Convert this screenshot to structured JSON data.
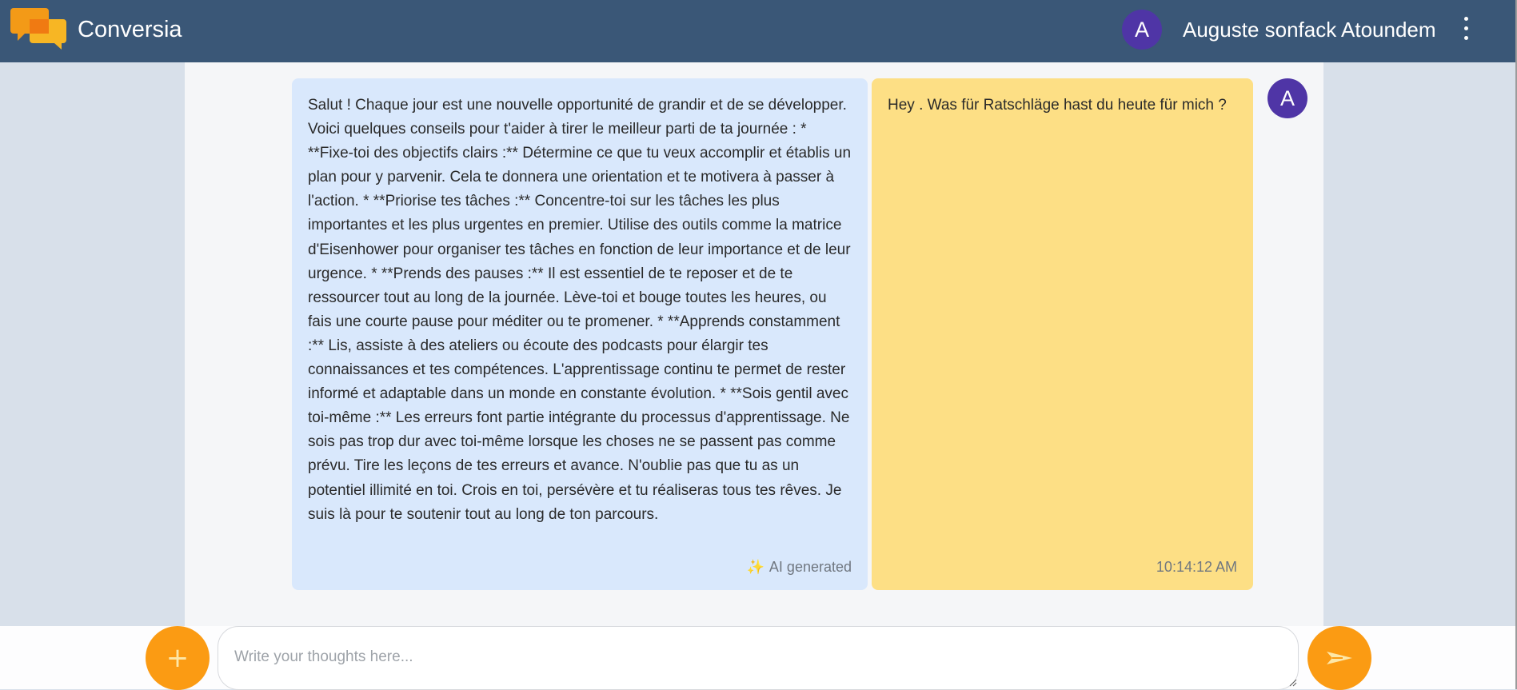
{
  "header": {
    "app_name": "Conversia",
    "user_initial": "A",
    "user_name": "Auguste sonfack Atoundem"
  },
  "chat": {
    "ai_message": {
      "text": "Salut ! Chaque jour est une nouvelle opportunité de grandir et de se développer. Voici quelques conseils pour t'aider à tirer le meilleur parti de ta journée : * **Fixe-toi des objectifs clairs :** Détermine ce que tu veux accomplir et établis un plan pour y parvenir. Cela te donnera une orientation et te motivera à passer à l'action. * **Priorise tes tâches :** Concentre-toi sur les tâches les plus importantes et les plus urgentes en premier. Utilise des outils comme la matrice d'Eisenhower pour organiser tes tâches en fonction de leur importance et de leur urgence. * **Prends des pauses :** Il est essentiel de te reposer et de te ressourcer tout au long de la journée. Lève-toi et bouge toutes les heures, ou fais une courte pause pour méditer ou te promener. * **Apprends constamment :** Lis, assiste à des ateliers ou écoute des podcasts pour élargir tes connaissances et tes compétences. L'apprentissage continu te permet de rester informé et adaptable dans un monde en constante évolution. * **Sois gentil avec toi-même :** Les erreurs font partie intégrante du processus d'apprentissage. Ne sois pas trop dur avec toi-même lorsque les choses ne se passent pas comme prévu. Tire les leçons de tes erreurs et avance. N'oublie pas que tu as un potentiel illimité en toi. Crois en toi, persévère et tu réaliseras tous tes rêves. Je suis là pour te soutenir tout au long de ton parcours.",
      "tag_icon": "✨",
      "tag": "AI generated"
    },
    "user_message": {
      "text": "Hey . Was für Ratschläge hast du heute für mich ?",
      "time": "10:14:12 AM",
      "avatar_initial": "A"
    }
  },
  "composer": {
    "placeholder": "Write your thoughts here...",
    "add_label": "+"
  },
  "colors": {
    "header_bg": "#3a5777",
    "avatar_bg": "#4f35a6",
    "ai_bubble": "#d9e8fc",
    "user_bubble": "#fddf85",
    "accent": "#fb9b13"
  },
  "icons": {
    "logo": "chat-bubbles-logo",
    "menu": "kebab-menu-icon",
    "add": "plus-icon",
    "send": "send-icon",
    "sparkle": "sparkle-icon"
  }
}
